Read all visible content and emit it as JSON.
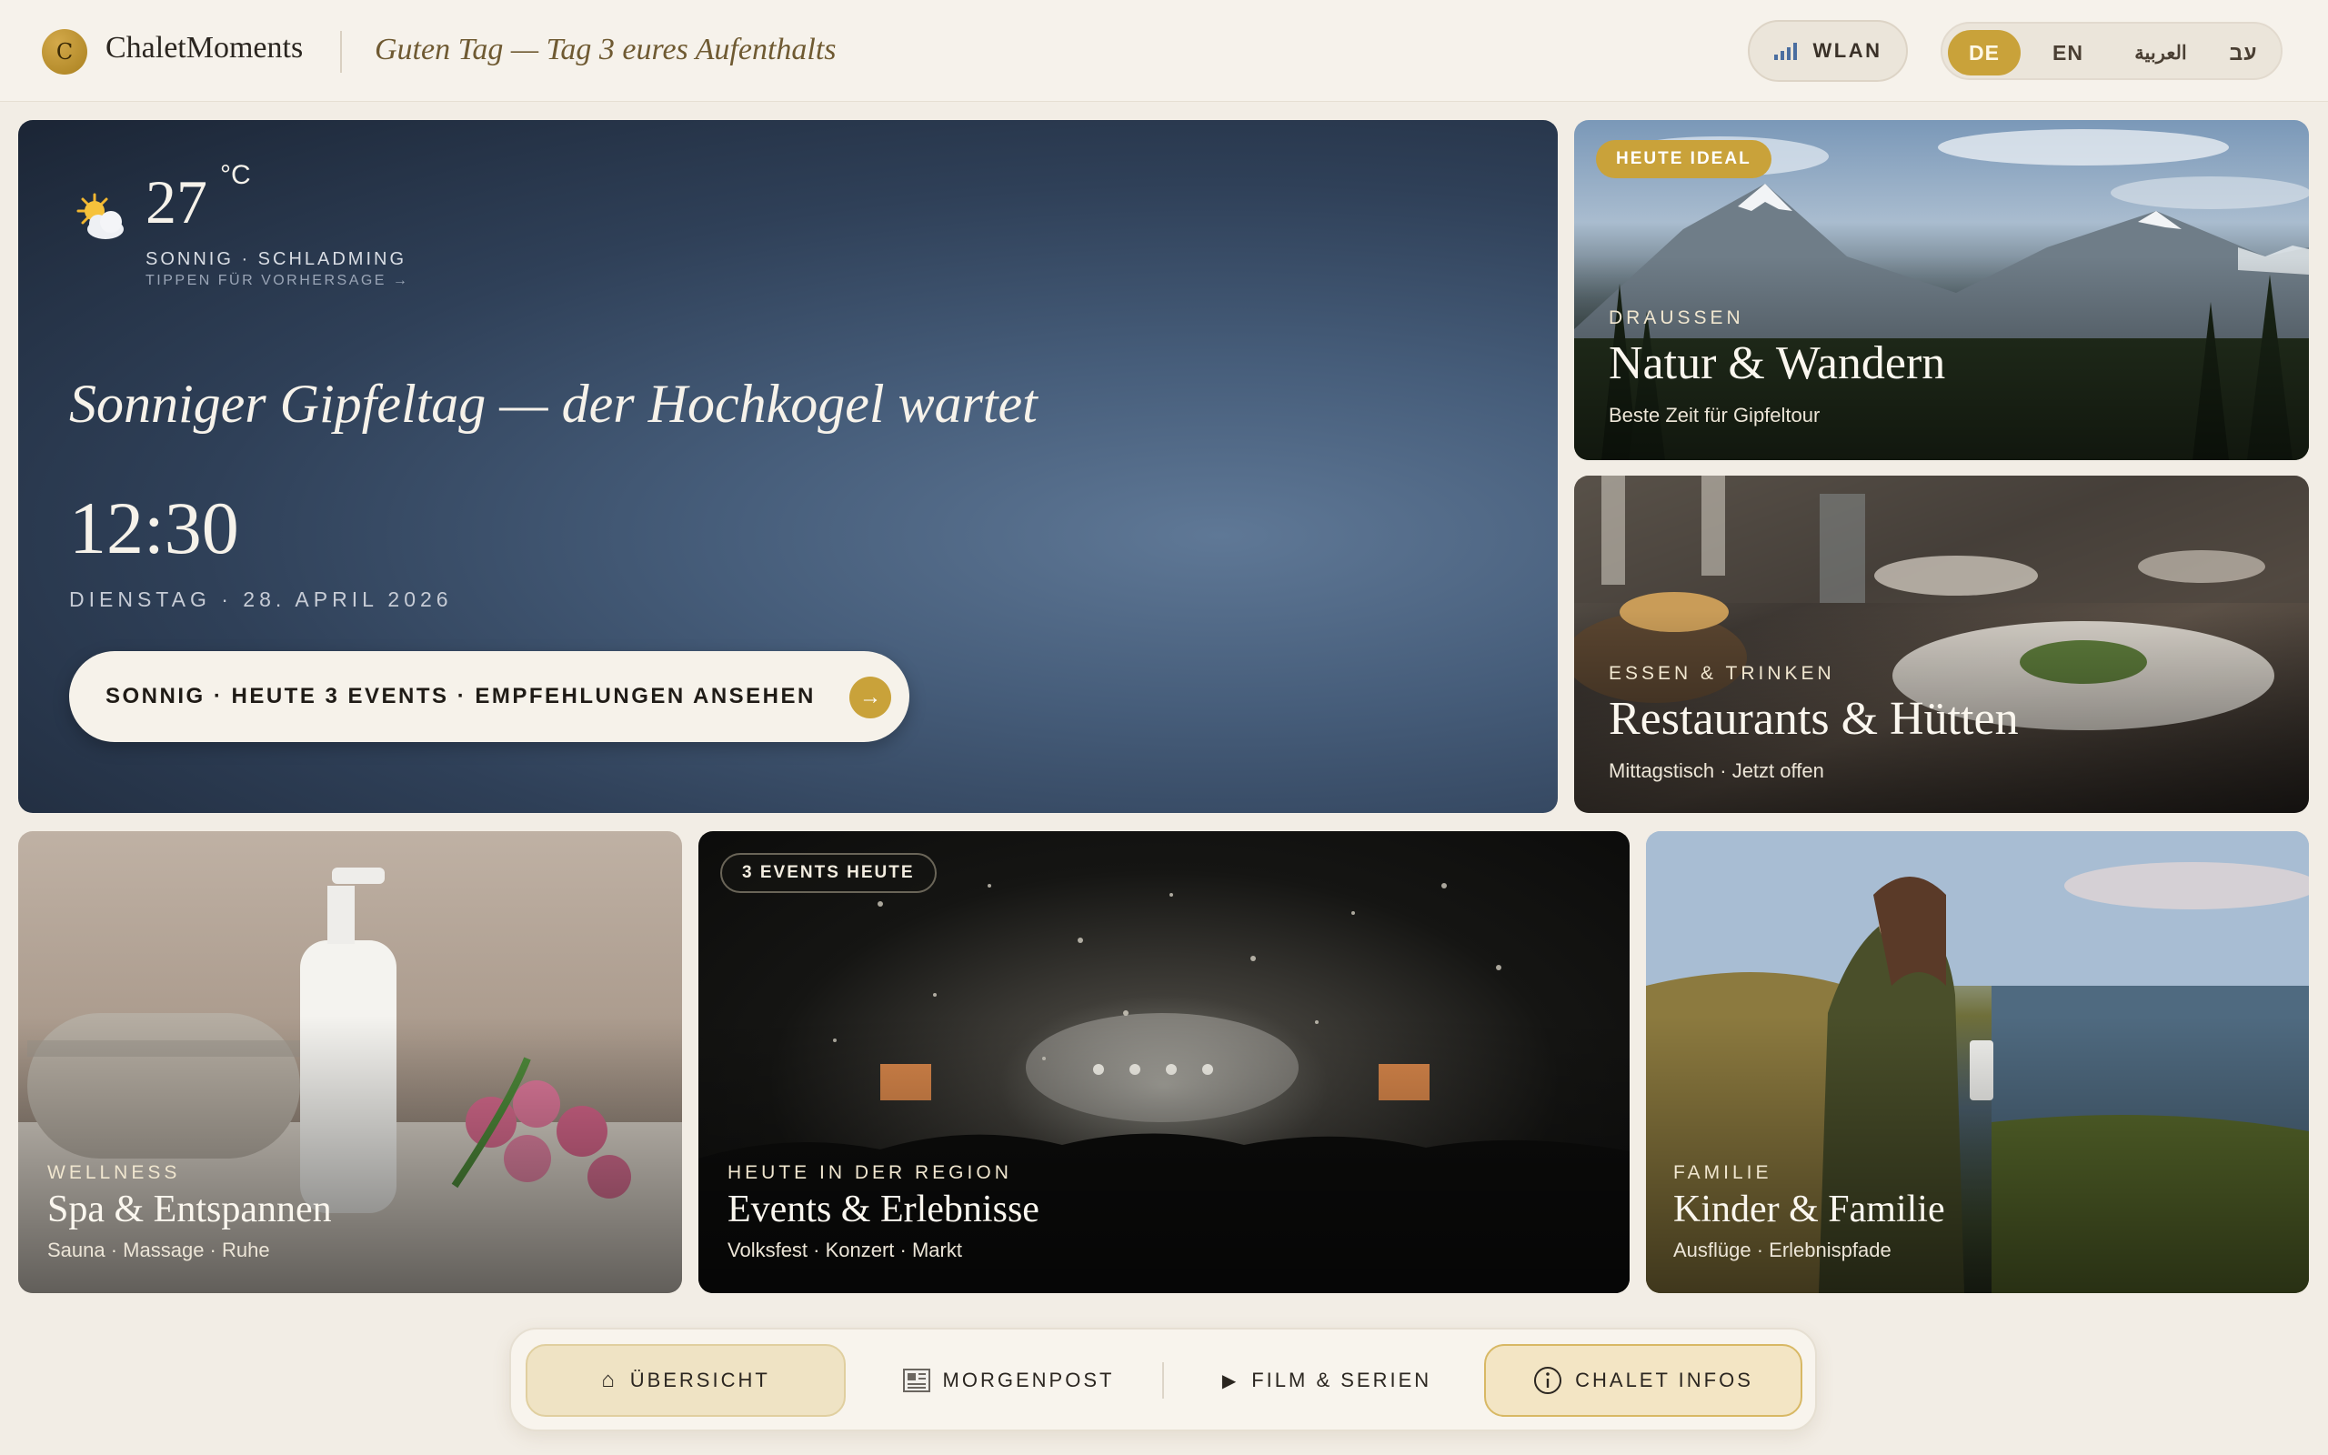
{
  "header": {
    "logo_letter": "C",
    "brand": "ChaletMoments",
    "greeting": "Guten Tag — Tag 3 eures Aufenthalts",
    "wifi_label": "WLAN",
    "languages": [
      {
        "code": "DE",
        "active": true
      },
      {
        "code": "EN",
        "active": false
      },
      {
        "code": "العربية",
        "active": false
      },
      {
        "code": "עב",
        "active": false
      }
    ]
  },
  "hero": {
    "temperature": "27",
    "temperature_unit": "°C",
    "condition": "SONNIG · SCHLADMING",
    "forecast_hint": "TIPPEN FÜR VORHERSAGE →",
    "headline": "Sonniger Gipfeltag — der Hochkogel wartet",
    "time": "12:30",
    "date": "DIENSTAG · 28. APRIL 2026",
    "cta_label": "SONNIG · HEUTE 3 EVENTS · EMPFEHLUNGEN ANSEHEN",
    "cta_arrow": "→"
  },
  "cards": {
    "nature": {
      "badge": "HEUTE IDEAL",
      "kicker": "DRAUSSEN",
      "title": "Natur & Wandern",
      "subtitle": "Beste Zeit für Gipfeltour"
    },
    "food": {
      "kicker": "ESSEN & TRINKEN",
      "title": "Restaurants & Hütten",
      "subtitle": "Mittagstisch · Jetzt offen"
    },
    "spa": {
      "kicker": "WELLNESS",
      "title": "Spa & Entspannen",
      "subtitle": "Sauna · Massage · Ruhe"
    },
    "events": {
      "badge": "3 EVENTS HEUTE",
      "kicker": "HEUTE IN DER REGION",
      "title": "Events & Erlebnisse",
      "subtitle": "Volksfest · Konzert · Markt"
    },
    "family": {
      "kicker": "FAMILIE",
      "title": "Kinder & Familie",
      "subtitle": "Ausflüge · Erlebnispfade"
    }
  },
  "nav": {
    "overview": "ÜBERSICHT",
    "newspaper": "MORGENPOST",
    "films": "FILM & SERIEN",
    "info": "CHALET INFOS"
  },
  "colors": {
    "accent": "#c9a23a",
    "background": "#f2ede5",
    "hero_dark": "#1b2535"
  }
}
